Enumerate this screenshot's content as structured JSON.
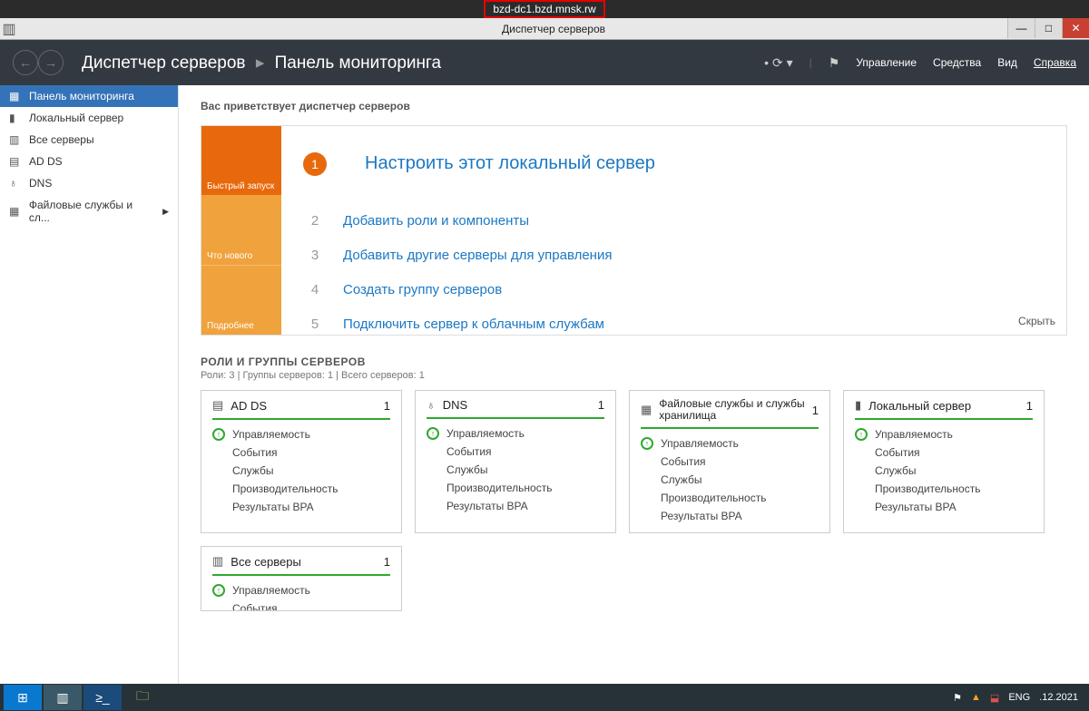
{
  "host": "bzd-dc1.bzd.mnsk.rw",
  "window_title": "Диспетчер серверов",
  "breadcrumb": {
    "root": "Диспетчер серверов",
    "page": "Панель мониторинга"
  },
  "menu": {
    "manage": "Управление",
    "tools": "Средства",
    "view": "Вид",
    "help": "Справка"
  },
  "sidebar": {
    "items": [
      {
        "label": "Панель мониторинга"
      },
      {
        "label": "Локальный сервер"
      },
      {
        "label": "Все серверы"
      },
      {
        "label": "AD DS"
      },
      {
        "label": "DNS"
      },
      {
        "label": "Файловые службы и сл..."
      }
    ]
  },
  "welcome": "Вас приветствует диспетчер серверов",
  "quick": {
    "seg1": "Быстрый запуск",
    "seg2": "Что нового",
    "seg3": "Подробнее",
    "steps": [
      {
        "n": "1",
        "label": "Настроить этот локальный сервер"
      },
      {
        "n": "2",
        "label": "Добавить роли и компоненты"
      },
      {
        "n": "3",
        "label": "Добавить другие серверы для управления"
      },
      {
        "n": "4",
        "label": "Создать группу серверов"
      },
      {
        "n": "5",
        "label": "Подключить сервер к облачным службам"
      }
    ],
    "hide": "Скрыть"
  },
  "roles": {
    "heading": "РОЛИ И ГРУППЫ СЕРВЕРОВ",
    "sub": "Роли: 3 | Группы серверов: 1 | Всего серверов: 1",
    "row_labels": {
      "manage": "Управляемость",
      "events": "События",
      "services": "Службы",
      "perf": "Производительность",
      "bpa": "Результаты BPA"
    },
    "cards": [
      {
        "title": "AD DS",
        "count": "1"
      },
      {
        "title": "DNS",
        "count": "1"
      },
      {
        "title": "Файловые службы и службы хранилища",
        "count": "1"
      },
      {
        "title": "Локальный сервер",
        "count": "1"
      },
      {
        "title": "Все серверы",
        "count": "1"
      }
    ]
  },
  "taskbar": {
    "lang": "ENG",
    "date": ".12.2021"
  }
}
